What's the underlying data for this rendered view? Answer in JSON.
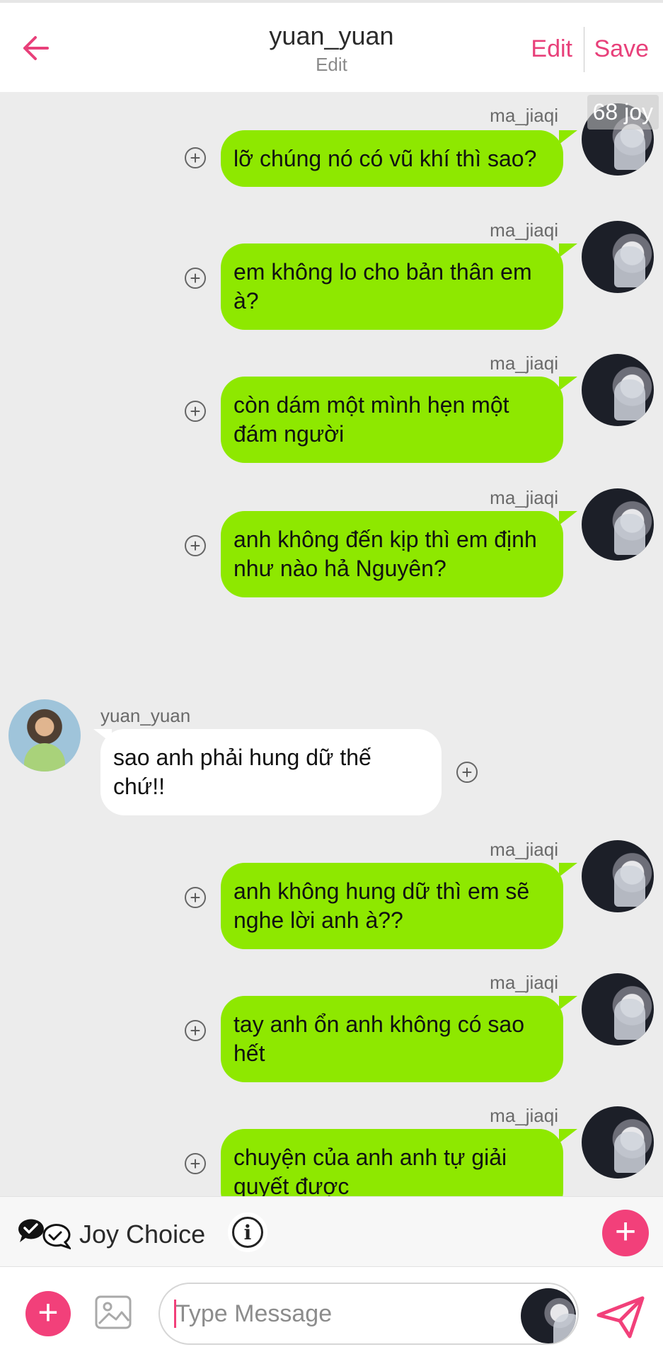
{
  "header": {
    "back_icon": "arrow-left-icon",
    "title": "yuan_yuan",
    "subtitle": "Edit",
    "edit_label": "Edit",
    "save_label": "Save",
    "accent_color": "#e8407a"
  },
  "watermark": "68 joy",
  "messages": [
    {
      "sender": "ma_jiaqi",
      "text": "lỡ chúng nó có vũ khí thì sao?",
      "side": "right"
    },
    {
      "sender": "ma_jiaqi",
      "text": "em không lo cho bản thân em à?",
      "side": "right"
    },
    {
      "sender": "ma_jiaqi",
      "text": "còn dám một mình hẹn một đám người",
      "side": "right"
    },
    {
      "sender": "ma_jiaqi",
      "text": "anh không đến kịp thì em định như nào hả Nguyên?",
      "side": "right"
    },
    {
      "sender": "yuan_yuan",
      "text": "sao anh phải hung dữ thế chứ!!",
      "side": "left"
    },
    {
      "sender": "ma_jiaqi",
      "text": "anh không hung dữ thì em sẽ nghe lời anh à??",
      "side": "right"
    },
    {
      "sender": "ma_jiaqi",
      "text": "tay anh ổn anh không có sao hết",
      "side": "right"
    },
    {
      "sender": "ma_jiaqi",
      "text": "chuyện của anh anh tự giải quyết được",
      "side": "right"
    },
    {
      "sender": "ma_jiaqi",
      "text": "",
      "side": "right"
    }
  ],
  "joy_choice": {
    "label": "Joy Choice",
    "icon": "chat-check-icon",
    "info_icon": "info-icon",
    "plus_icon": "plus-icon"
  },
  "composer": {
    "placeholder": "Type Message",
    "value": "",
    "add_icon": "plus-icon",
    "image_icon": "image-icon",
    "send_icon": "send-icon"
  },
  "colors": {
    "outgoing_bubble": "#8ee800",
    "incoming_bubble": "#ffffff",
    "background": "#ececec",
    "pink": "#f2407a"
  }
}
